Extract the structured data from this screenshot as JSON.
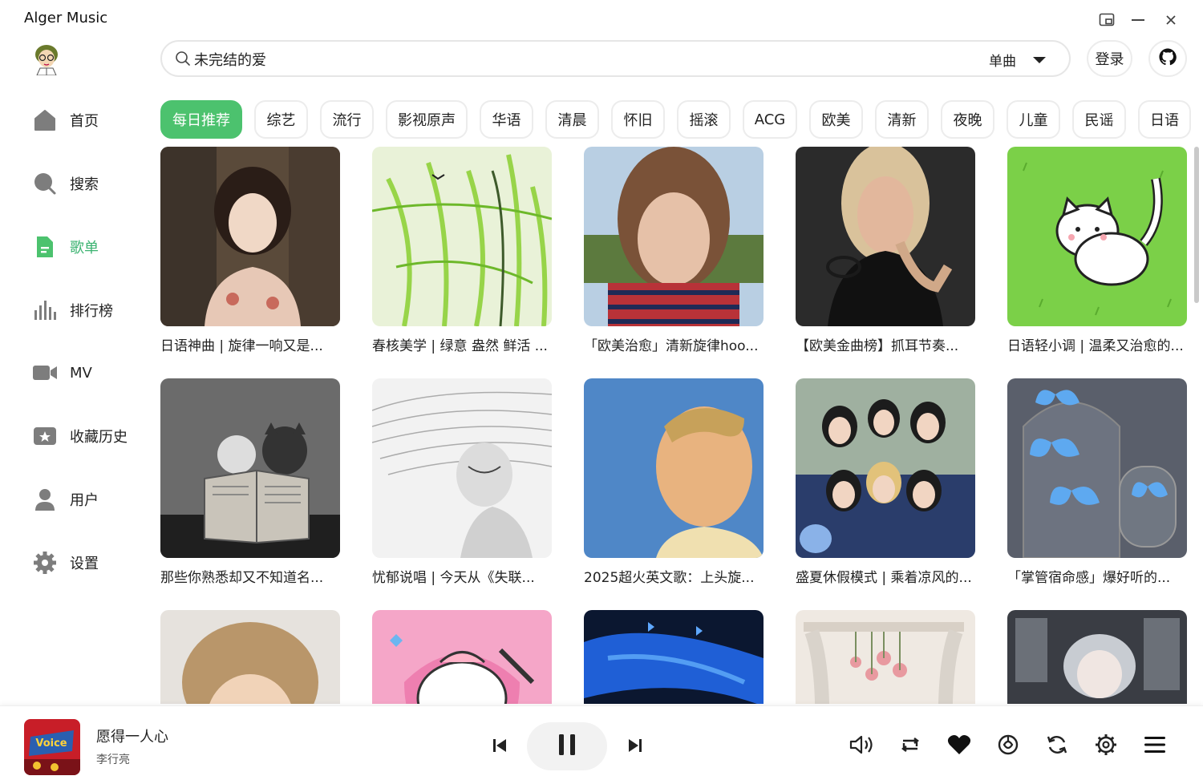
{
  "app": {
    "title": "Alger Music"
  },
  "sidebar": {
    "items": [
      {
        "label": "首页",
        "icon": "home-icon"
      },
      {
        "label": "搜索",
        "icon": "search-icon"
      },
      {
        "label": "歌单",
        "icon": "playlist-icon",
        "active": true
      },
      {
        "label": "排行榜",
        "icon": "chart-icon"
      },
      {
        "label": "MV",
        "icon": "video-icon"
      },
      {
        "label": "收藏历史",
        "icon": "star-icon"
      },
      {
        "label": "用户",
        "icon": "user-icon"
      },
      {
        "label": "设置",
        "icon": "gear-icon"
      }
    ]
  },
  "search": {
    "value": "未完结的爱",
    "type": "单曲"
  },
  "header": {
    "login_label": "登录"
  },
  "categories": [
    "每日推荐",
    "综艺",
    "流行",
    "影视原声",
    "华语",
    "清晨",
    "怀旧",
    "摇滚",
    "ACG",
    "欧美",
    "清新",
    "夜晚",
    "儿童",
    "民谣",
    "日语"
  ],
  "playlists": [
    {
      "title": "日语神曲 | 旋律一响又是..."
    },
    {
      "title": "春核美学 | 绿意 盎然 鲜活 ..."
    },
    {
      "title": "「欧美治愈」清新旋律hoo..."
    },
    {
      "title": "【欧美金曲榜】抓耳节奏..."
    },
    {
      "title": "日语轻小调 | 温柔又治愈的..."
    },
    {
      "title": "那些你熟悉却又不知道名..."
    },
    {
      "title": "忧郁说唱 | 今天从《失联..."
    },
    {
      "title": "2025超火英文歌：上头旋..."
    },
    {
      "title": "盛夏休假模式 | 乘着凉风的..."
    },
    {
      "title": "「掌管宿命感」爆好听的..."
    },
    {
      "title": ""
    },
    {
      "title": ""
    },
    {
      "title": ""
    },
    {
      "title": ""
    },
    {
      "title": ""
    }
  ],
  "player": {
    "title": "愿得一人心",
    "artist": "李行亮",
    "cover_text": "Voice"
  },
  "colors": {
    "accent": "#4cc26e",
    "accent_text": "#3cb371"
  }
}
